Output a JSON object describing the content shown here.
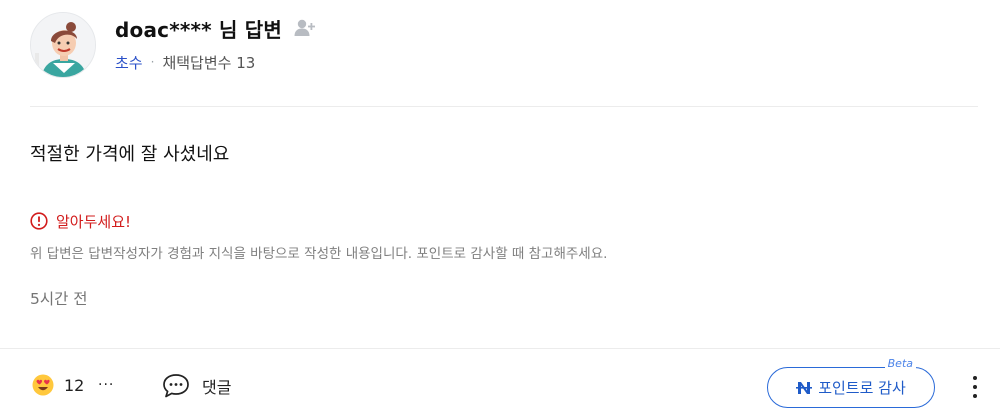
{
  "author": {
    "name": "doac**** 님 답변",
    "grade": "초수",
    "separator": "·",
    "adopted_count": "채택답변수 13"
  },
  "answer": {
    "text": "적절한 가격에 잘 사셨네요"
  },
  "notice": {
    "title": "알아두세요!",
    "body": "위 답변은 답변작성자가 경험과 지식을 바탕으로 작성한 내용입니다. 포인트로 감사할 때 참고해주세요."
  },
  "time": "5시간 전",
  "footer": {
    "reaction_count": "12",
    "more_label": "···",
    "comment_label": "댓글",
    "thanks_label": "포인트로 감사",
    "beta_label": "Beta"
  },
  "icons": {
    "follow": "add-user-icon",
    "warning": "alert-circle-icon",
    "reaction": "heart-eyes-emoji-icon",
    "comment": "speech-bubble-icon",
    "points": "n-points-icon",
    "kebab": "vertical-ellipsis-icon"
  },
  "colors": {
    "grade": "#2a50c8",
    "notice": "#d21c1c",
    "accent": "#2a6ad8"
  }
}
